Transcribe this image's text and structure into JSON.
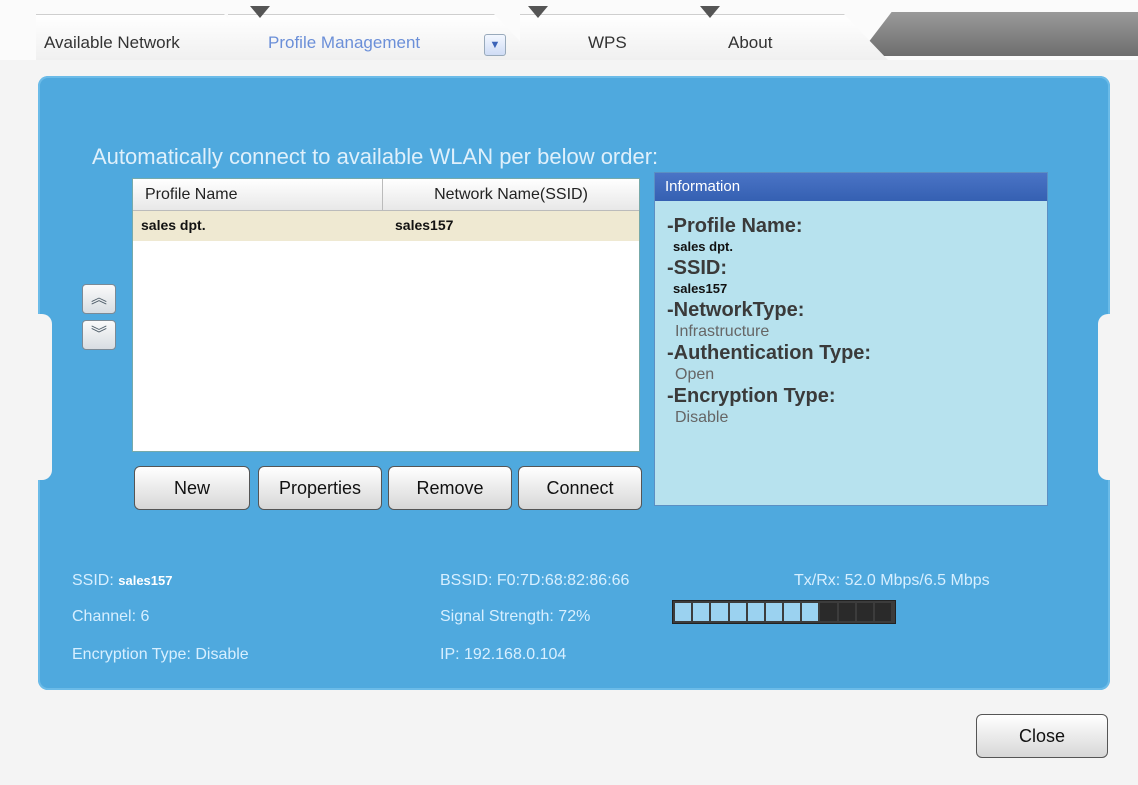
{
  "tabs": [
    {
      "label": "Available Network"
    },
    {
      "label": "Profile Management"
    },
    {
      "label": "WPS"
    },
    {
      "label": "About"
    }
  ],
  "dropdown_icon": "chevron-down-icon",
  "auto_connect_text": "Automatically connect to available WLAN per below order:",
  "profile_list": {
    "headers": [
      "Profile Name",
      "Network Name(SSID)"
    ],
    "rows": [
      {
        "profile": "sales dpt.",
        "ssid": "sales157"
      }
    ]
  },
  "order_buttons": {
    "up_icon": "double-chevron-up-icon",
    "down_icon": "double-chevron-down-icon"
  },
  "buttons": {
    "new": "New",
    "properties": "Properties",
    "remove": "Remove",
    "connect": "Connect",
    "close": "Close"
  },
  "info": {
    "title": "Information",
    "profile_name_label": "-Profile Name:",
    "profile_name": "sales dpt.",
    "ssid_label": "-SSID:",
    "ssid": "sales157",
    "network_type_label": "-NetworkType:",
    "network_type": "Infrastructure",
    "auth_type_label": "-Authentication Type:",
    "auth_type": "Open",
    "encryption_type_label": "-Encryption Type:",
    "encryption_type": "Disable"
  },
  "status": {
    "ssid_label": "SSID:",
    "ssid": "sales157",
    "channel": "Channel: 6",
    "encryption": "Encryption Type: Disable",
    "bssid": "BSSID: F0:7D:68:82:86:66",
    "signal": "Signal Strength: 72%",
    "signal_percent": 72,
    "ip": "IP: 192.168.0.104",
    "txrx": "Tx/Rx: 52.0 Mbps/6.5 Mbps"
  },
  "colors": {
    "panel_blue": "#4fa9de",
    "info_header": "#3f69bc",
    "active_tab_text": "#6b8fd8"
  }
}
